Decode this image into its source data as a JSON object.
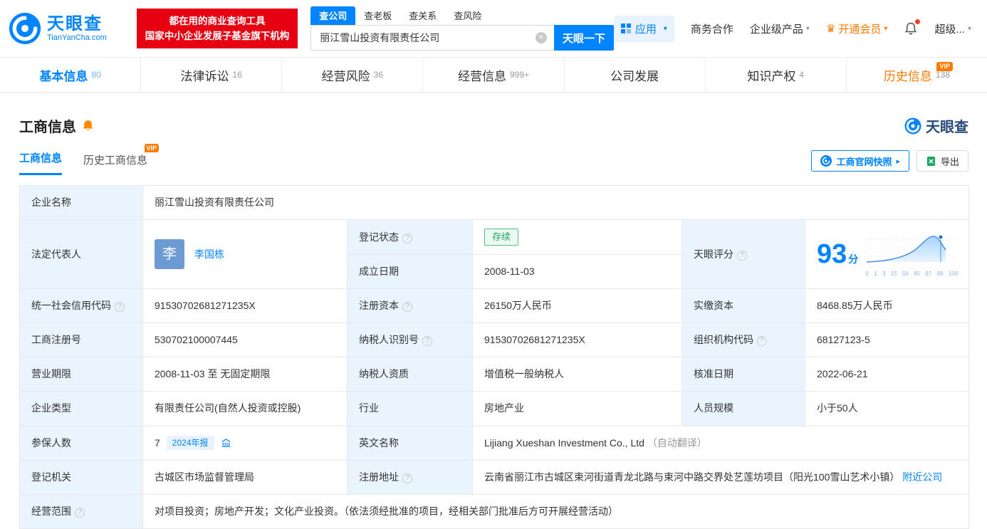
{
  "colors": {
    "accent": "#0084ff",
    "orange": "#ff7a00",
    "green": "#1ea95d",
    "red_banner": "#e60012"
  },
  "vip_label": "VIP",
  "icons": {
    "help": "?",
    "clear": "×",
    "caret_down": "▾",
    "caret_right": "▸",
    "crown": "♛"
  },
  "brand": {
    "name": "天眼查",
    "domain": "TianYanCha.com"
  },
  "header": {
    "promo_line1": "都在用的商业查询工具",
    "promo_line2": "国家中小企业发展子基金旗下机构",
    "search_tabs": [
      "查公司",
      "查老板",
      "查关系",
      "查风险"
    ],
    "search_value": "丽江雪山投资有限责任公司",
    "search_button": "天眼一下",
    "nav_app": "应用",
    "nav_items": [
      "商务合作",
      "企业级产品",
      "开通会员",
      "超级..."
    ]
  },
  "tabs": [
    {
      "label": "基本信息",
      "count": "80"
    },
    {
      "label": "法律诉讼",
      "count": "16"
    },
    {
      "label": "经营风险",
      "count": "36"
    },
    {
      "label": "经营信息",
      "count": "999+"
    },
    {
      "label": "公司发展",
      "count": ""
    },
    {
      "label": "知识产权",
      "count": "4"
    },
    {
      "label": "历史信息",
      "count": "138"
    }
  ],
  "section": {
    "title": "工商信息",
    "logo": "天眼查",
    "subtab_active": "工商信息",
    "subtab_vip": "历史工商信息",
    "btn_snapshot": "工商官网快照",
    "btn_export": "导出"
  },
  "fields": {
    "company_name_label": "企业名称",
    "company_name": "丽江雪山投资有限责任公司",
    "legal_rep_label": "法定代表人",
    "legal_rep_avatar": "李",
    "legal_rep_name": "李国栋",
    "reg_status_label": "登记状态",
    "reg_status": "存续",
    "establish_date_label": "成立日期",
    "establish_date": "2008-11-03",
    "score_label": "天眼评分",
    "score_value": "93",
    "score_unit": "分",
    "credit_code_label": "统一社会信用代码",
    "credit_code": "91530702681271235X",
    "reg_capital_label": "注册资本",
    "reg_capital": "26150万人民币",
    "paid_capital_label": "实缴资本",
    "paid_capital": "8468.85万人民币",
    "reg_number_label": "工商注册号",
    "reg_number": "530702100007445",
    "taxpayer_id_label": "纳税人识别号",
    "taxpayer_id": "91530702681271235X",
    "org_code_label": "组织机构代码",
    "org_code": "68127123-5",
    "business_term_label": "营业期限",
    "business_term": "2008-11-03 至 无固定期限",
    "taxpayer_quality_label": "纳税人资质",
    "taxpayer_quality": "增值税一般纳税人",
    "approval_date_label": "核准日期",
    "approval_date": "2022-06-21",
    "company_type_label": "企业类型",
    "company_type": "有限责任公司(自然人投资或控股)",
    "industry_label": "行业",
    "industry": "房地产业",
    "staff_size_label": "人员规模",
    "staff_size": "小于50人",
    "insured_label": "参保人数",
    "insured_count": "7",
    "insured_tag": "2024年报",
    "english_name_label": "英文名称",
    "english_name": "Lijiang Xueshan Investment Co., Ltd",
    "english_name_note": "（自动翻译）",
    "reg_authority_label": "登记机关",
    "reg_authority": "古城区市场监督管理局",
    "address_label": "注册地址",
    "address": "云南省丽江市古城区束河街道青龙北路与束河中路交界处艺莲坊项目（阳光100雪山艺术小镇）",
    "address_link": "附近公司",
    "scope_label": "经营范围",
    "scope": "对项目投资；房地产开发；文化产业投资。（依法须经批准的项目，经相关部门批准后方可开展经营活动）"
  },
  "score_chart": {
    "ticks": [
      "0",
      "1",
      "3",
      "15",
      "50",
      "85",
      "97",
      "99",
      "100"
    ]
  }
}
